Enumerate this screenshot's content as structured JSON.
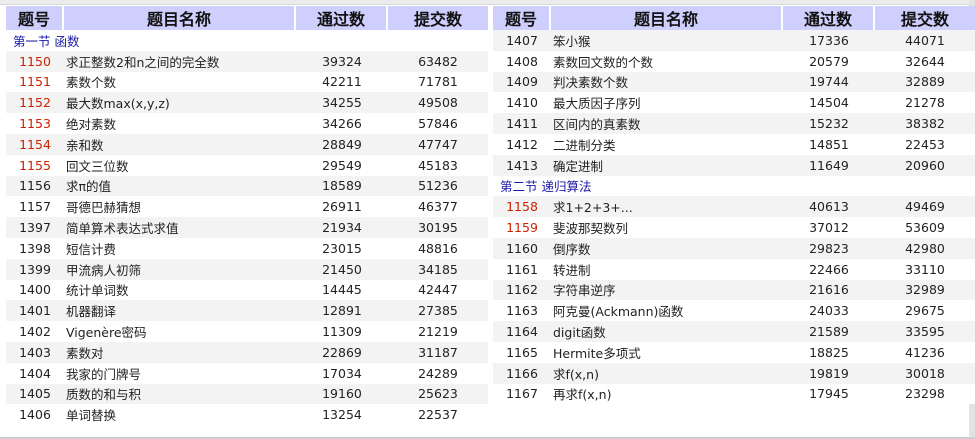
{
  "headers": [
    "题号",
    "题目名称",
    "通过数",
    "提交数"
  ],
  "left": {
    "section_title": "第一节 函数",
    "rows": [
      {
        "id": "1150",
        "name": "求正整数2和n之间的完全数",
        "passed": "39324",
        "submitted": "63482",
        "highlight": true
      },
      {
        "id": "1151",
        "name": "素数个数",
        "passed": "42211",
        "submitted": "71781",
        "highlight": true
      },
      {
        "id": "1152",
        "name": "最大数max(x,y,z)",
        "passed": "34255",
        "submitted": "49508",
        "highlight": true
      },
      {
        "id": "1153",
        "name": "绝对素数",
        "passed": "34266",
        "submitted": "57846",
        "highlight": true
      },
      {
        "id": "1154",
        "name": "亲和数",
        "passed": "28849",
        "submitted": "47747",
        "highlight": true
      },
      {
        "id": "1155",
        "name": "回文三位数",
        "passed": "29549",
        "submitted": "45183",
        "highlight": true
      },
      {
        "id": "1156",
        "name": "求π的值",
        "passed": "18589",
        "submitted": "51236",
        "highlight": false
      },
      {
        "id": "1157",
        "name": "哥德巴赫猜想",
        "passed": "26911",
        "submitted": "46377",
        "highlight": false
      },
      {
        "id": "1397",
        "name": "简单算术表达式求值",
        "passed": "21934",
        "submitted": "30195",
        "highlight": false
      },
      {
        "id": "1398",
        "name": "短信计费",
        "passed": "23015",
        "submitted": "48816",
        "highlight": false
      },
      {
        "id": "1399",
        "name": "甲流病人初筛",
        "passed": "21450",
        "submitted": "34185",
        "highlight": false
      },
      {
        "id": "1400",
        "name": "统计单词数",
        "passed": "14445",
        "submitted": "42447",
        "highlight": false
      },
      {
        "id": "1401",
        "name": "机器翻译",
        "passed": "12891",
        "submitted": "27385",
        "highlight": false
      },
      {
        "id": "1402",
        "name": "Vigenère密码",
        "passed": "11309",
        "submitted": "21219",
        "highlight": false
      },
      {
        "id": "1403",
        "name": "素数对",
        "passed": "22869",
        "submitted": "31187",
        "highlight": false
      },
      {
        "id": "1404",
        "name": "我家的门牌号",
        "passed": "17034",
        "submitted": "24289",
        "highlight": false
      },
      {
        "id": "1405",
        "name": "质数的和与积",
        "passed": "19160",
        "submitted": "25623",
        "highlight": false
      },
      {
        "id": "1406",
        "name": "单词替换",
        "passed": "13254",
        "submitted": "22537",
        "highlight": false
      }
    ]
  },
  "right": {
    "rows_before": [
      {
        "id": "1407",
        "name": "笨小猴",
        "passed": "17336",
        "submitted": "44071",
        "highlight": false
      },
      {
        "id": "1408",
        "name": "素数回文数的个数",
        "passed": "20579",
        "submitted": "32644",
        "highlight": false
      },
      {
        "id": "1409",
        "name": "判决素数个数",
        "passed": "19744",
        "submitted": "32889",
        "highlight": false
      },
      {
        "id": "1410",
        "name": "最大质因子序列",
        "passed": "14504",
        "submitted": "21278",
        "highlight": false
      },
      {
        "id": "1411",
        "name": "区间内的真素数",
        "passed": "15232",
        "submitted": "38382",
        "highlight": false
      },
      {
        "id": "1412",
        "name": "二进制分类",
        "passed": "14851",
        "submitted": "22453",
        "highlight": false
      },
      {
        "id": "1413",
        "name": "确定进制",
        "passed": "11649",
        "submitted": "20960",
        "highlight": false
      }
    ],
    "section_title": "第二节 递归算法",
    "rows_after": [
      {
        "id": "1158",
        "name": "求1+2+3+...",
        "passed": "40613",
        "submitted": "49469",
        "highlight": true
      },
      {
        "id": "1159",
        "name": "斐波那契数列",
        "passed": "37012",
        "submitted": "53609",
        "highlight": true
      },
      {
        "id": "1160",
        "name": "倒序数",
        "passed": "29823",
        "submitted": "42980",
        "highlight": false
      },
      {
        "id": "1161",
        "name": "转进制",
        "passed": "22466",
        "submitted": "33110",
        "highlight": false
      },
      {
        "id": "1162",
        "name": "字符串逆序",
        "passed": "21616",
        "submitted": "32989",
        "highlight": false
      },
      {
        "id": "1163",
        "name": "阿克曼(Ackmann)函数",
        "passed": "24033",
        "submitted": "29675",
        "highlight": false
      },
      {
        "id": "1164",
        "name": "digit函数",
        "passed": "21589",
        "submitted": "33595",
        "highlight": false
      },
      {
        "id": "1165",
        "name": "Hermite多项式",
        "passed": "18825",
        "submitted": "41236",
        "highlight": false
      },
      {
        "id": "1166",
        "name": "求f(x,n)",
        "passed": "19819",
        "submitted": "30018",
        "highlight": false
      },
      {
        "id": "1167",
        "name": "再求f(x,n)",
        "passed": "17945",
        "submitted": "23298",
        "highlight": false
      }
    ]
  },
  "colors": {
    "header_bg": "#cfcffe",
    "row_alt_bg": "#f3f3f3",
    "section_text": "#1a1aa6",
    "highlight_id": "#cc2200"
  }
}
